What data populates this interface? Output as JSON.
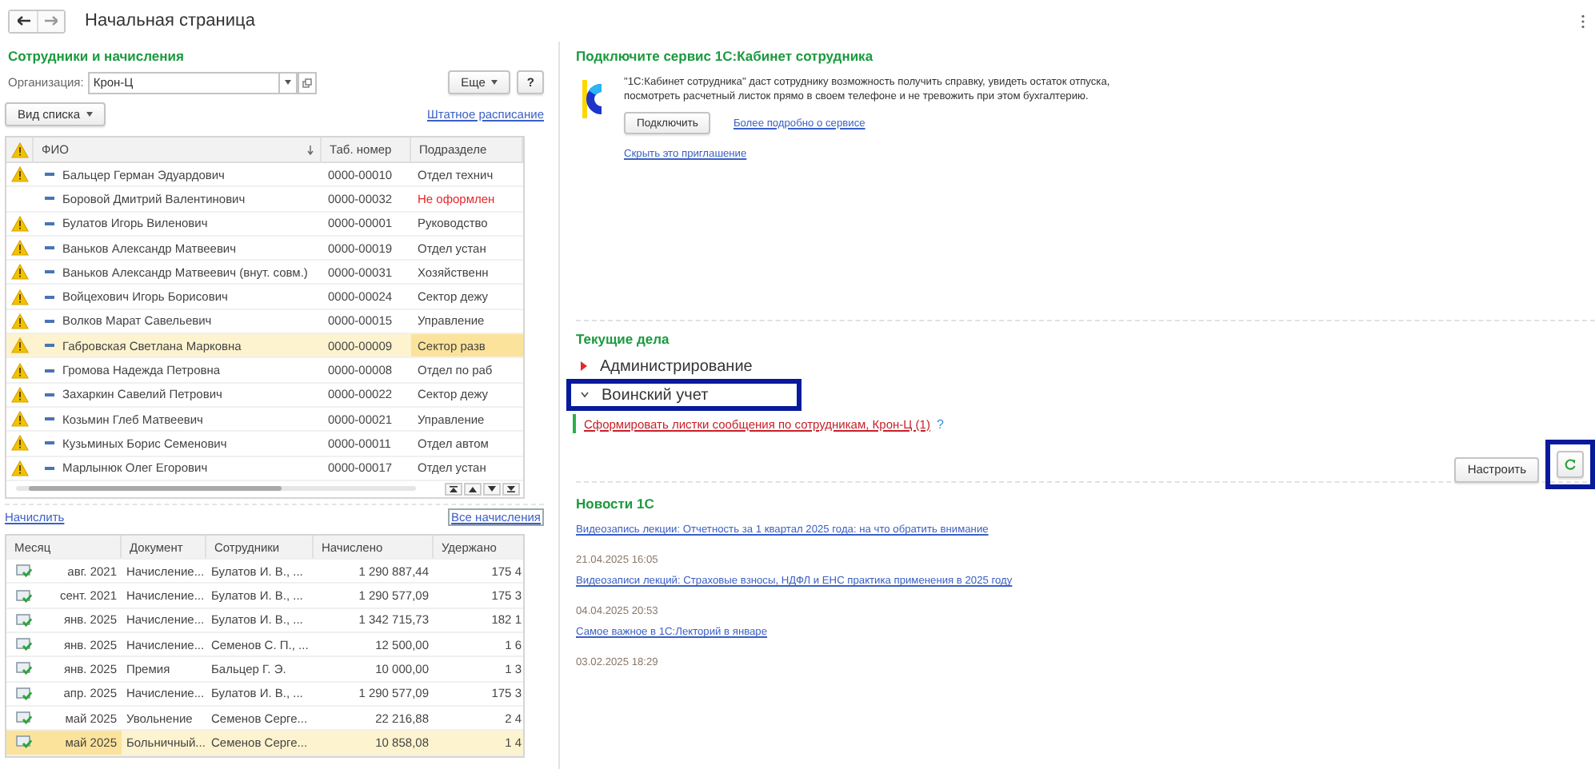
{
  "window": {
    "title": "Начальная страница"
  },
  "employees": {
    "title": "Сотрудники и начисления",
    "organization_label": "Организация:",
    "organization": "Крон-Ц",
    "more_button": "Еще",
    "help_button": "?",
    "view_button": "Вид списка",
    "staffing_link": "Штатное расписание",
    "columns": [
      "ФИО",
      "Таб. номер",
      "Подразделе"
    ],
    "rows": [
      {
        "warning": true,
        "name": "Бальцер Герман Эдуардович",
        "number": "0000-00010",
        "department": "Отдел технич",
        "error": false,
        "selected": false
      },
      {
        "warning": false,
        "name": "Боровой Дмитрий Валентинович",
        "number": "0000-00032",
        "department": "Не оформлен",
        "error": true,
        "selected": false
      },
      {
        "warning": true,
        "name": "Булатов Игорь Виленович",
        "number": "0000-00001",
        "department": "Руководство",
        "error": false,
        "selected": false
      },
      {
        "warning": true,
        "name": "Ваньков Александр Матвеевич",
        "number": "0000-00019",
        "department": "Отдел устан",
        "error": false,
        "selected": false
      },
      {
        "warning": true,
        "name": "Ваньков Александр Матвеевич (внут. совм.)",
        "number": "0000-00031",
        "department": "Хозяйственн",
        "error": false,
        "selected": false
      },
      {
        "warning": true,
        "name": "Войцехович Игорь Борисович",
        "number": "0000-00024",
        "department": "Сектор дежу",
        "error": false,
        "selected": false
      },
      {
        "warning": true,
        "name": "Волков Марат Савельевич",
        "number": "0000-00015",
        "department": "Управление",
        "error": false,
        "selected": false
      },
      {
        "warning": true,
        "name": "Габровская Светлана Марковна",
        "number": "0000-00009",
        "department": "Сектор разв",
        "error": false,
        "selected": true
      },
      {
        "warning": true,
        "name": "Громова Надежда Петровна",
        "number": "0000-00008",
        "department": "Отдел по раб",
        "error": false,
        "selected": false
      },
      {
        "warning": true,
        "name": "Захаркин Савелий Петрович",
        "number": "0000-00022",
        "department": "Сектор дежу",
        "error": false,
        "selected": false
      },
      {
        "warning": true,
        "name": "Козьмин Глеб Матвеевич",
        "number": "0000-00021",
        "department": "Управление",
        "error": false,
        "selected": false
      },
      {
        "warning": true,
        "name": "Кузьминых Борис Семенович",
        "number": "0000-00011",
        "department": "Отдел автом",
        "error": false,
        "selected": false
      },
      {
        "warning": true,
        "name": "Марлынюк Олег Егорович",
        "number": "0000-00017",
        "department": "Отдел устан",
        "error": false,
        "selected": false
      }
    ]
  },
  "accruals": {
    "accrue_link": "Начислить",
    "all_link": "Все начисления",
    "columns": [
      "Месяц",
      "Документ",
      "Сотрудники",
      "Начислено",
      "Удержано"
    ],
    "rows": [
      {
        "month": "авг. 2021",
        "document": "Начисление...",
        "employees": "Булатов И. В., ...",
        "accrued": "1 290 887,44",
        "withheld": "175 4",
        "selected": false
      },
      {
        "month": "сент. 2021",
        "document": "Начисление...",
        "employees": "Булатов И. В., ...",
        "accrued": "1 290 577,09",
        "withheld": "175 3",
        "selected": false
      },
      {
        "month": "янв. 2025",
        "document": "Начисление...",
        "employees": "Булатов И. В., ...",
        "accrued": "1 342 715,73",
        "withheld": "182 1",
        "selected": false
      },
      {
        "month": "янв. 2025",
        "document": "Начисление...",
        "employees": "Семенов С. П., ...",
        "accrued": "12 500,00",
        "withheld": "1 6",
        "selected": false
      },
      {
        "month": "янв. 2025",
        "document": "Премия",
        "employees": "Бальцер Г. Э.",
        "accrued": "10 000,00",
        "withheld": "1 3",
        "selected": false
      },
      {
        "month": "апр. 2025",
        "document": "Начисление...",
        "employees": "Булатов И. В., ...",
        "accrued": "1 290 577,09",
        "withheld": "175 3",
        "selected": false
      },
      {
        "month": "май 2025",
        "document": "Увольнение",
        "employees": "Семенов Серге...",
        "accrued": "22 216,88",
        "withheld": "2 4",
        "selected": false
      },
      {
        "month": "май 2025",
        "document": "Больничный...",
        "employees": "Семенов Серге...",
        "accrued": "10 858,08",
        "withheld": "1 4",
        "selected": true
      }
    ]
  },
  "service": {
    "title": "Подключите сервис 1С:Кабинет сотрудника",
    "text": "\"1С:Кабинет сотрудника\" даст сотруднику возможность получить справку, увидеть остаток отпуска, посмотреть расчетный листок прямо в своем телефоне и не тревожить при этом бухгалтерию.",
    "connect_button": "Подключить",
    "details_link": "Более подробно о сервисе",
    "hide_link": "Скрыть это приглашение"
  },
  "tasks": {
    "title": "Текущие дела",
    "groups": [
      {
        "label": "Администрирование",
        "expanded": false,
        "highlighted": false
      },
      {
        "label": "Воинский учет",
        "expanded": true,
        "highlighted": true,
        "children": [
          {
            "label": "Сформировать листки сообщения по сотрудникам, Крон-Ц (1)",
            "help": "?"
          }
        ]
      }
    ],
    "configure_button": "Настроить",
    "refresh_highlighted": true
  },
  "news": {
    "title": "Новости 1С",
    "items": [
      {
        "title": "Видеозапись лекции: Отчетность за 1 квартал 2025 года: на что обратить внимание",
        "date": "21.04.2025 16:05"
      },
      {
        "title": "Видеозаписи лекций: Страховые взносы, НДФЛ и ЕНС практика применения в 2025 году",
        "date": "04.04.2025 20:53"
      },
      {
        "title": "Самое важное в 1С:Лекторий в январе",
        "date": "03.02.2025 18:29"
      }
    ]
  }
}
